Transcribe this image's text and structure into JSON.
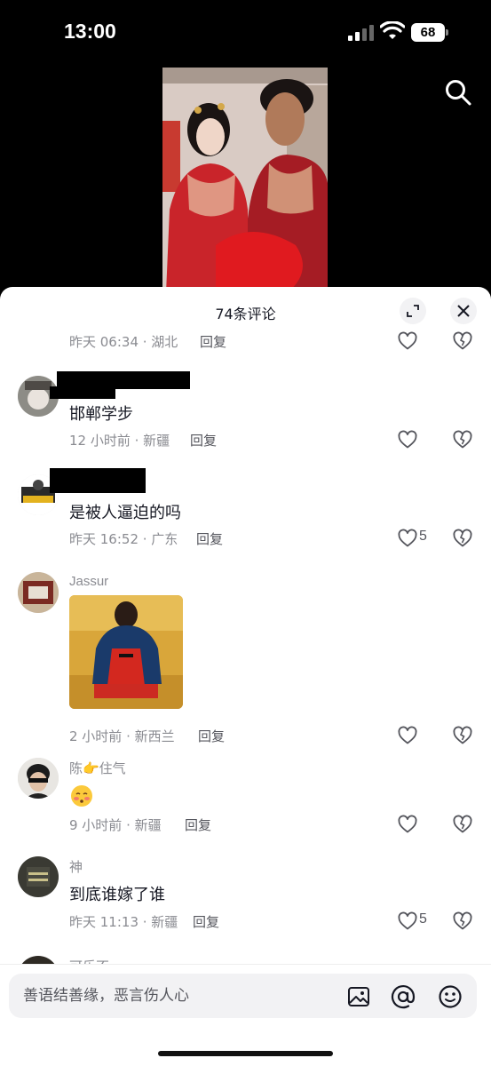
{
  "status": {
    "time": "13:00",
    "battery": "68"
  },
  "sheet": {
    "title": "74条评论"
  },
  "comments": [
    {
      "meta": "昨天 06:34 · 湖北",
      "reply": "回复",
      "likes": ""
    },
    {
      "username": "",
      "text": "邯郸学步",
      "meta": "12 小时前 · 新疆",
      "reply": "回复",
      "likes": ""
    },
    {
      "username": "",
      "text": "是被人逼迫的吗",
      "meta": "昨天 16:52 · 广东",
      "reply": "回复",
      "likes": "5"
    },
    {
      "username": "Jassur",
      "meta": "2 小时前 · 新西兰",
      "reply": "回复",
      "likes": ""
    },
    {
      "username": "陈👉住气",
      "meta": "9 小时前 · 新疆",
      "reply": "回复",
      "likes": ""
    },
    {
      "username": "神",
      "text": "到底谁嫁了谁",
      "meta": "昨天 11:13 · 新疆",
      "reply": "回复",
      "likes": "5"
    },
    {
      "username": "可乐不ama"
    }
  ],
  "input": {
    "placeholder": "善语结善缘，恶言伤人心"
  },
  "icons": {
    "search": "search-icon",
    "expand": "expand-icon",
    "close": "close-icon",
    "like": "heart-icon",
    "dislike": "broken-heart-icon",
    "image": "image-icon",
    "mention": "at-icon",
    "emoji": "emoji-icon"
  }
}
